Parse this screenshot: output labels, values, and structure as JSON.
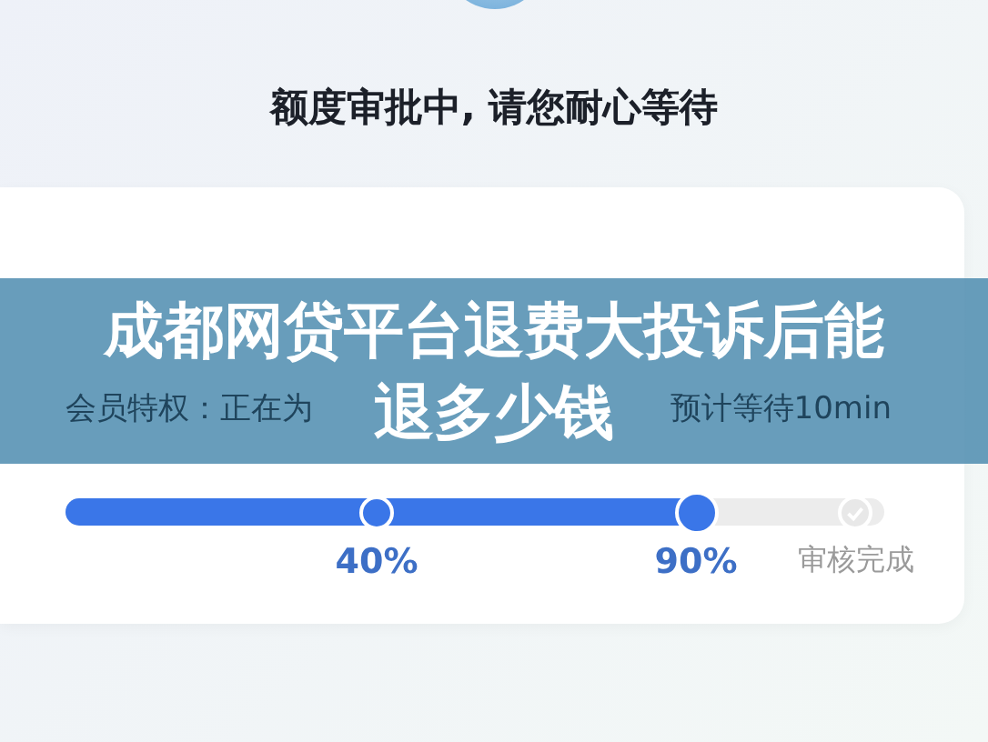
{
  "status_title": "额度审批中, 请您耐心等待",
  "card": {
    "subtitle_parts": [
      "会员特权：正在为",
      "预计等待10min"
    ]
  },
  "progress": {
    "level": 0.77,
    "steps": [
      {
        "label": "40%",
        "done": true
      },
      {
        "label": "90%",
        "done": true
      },
      {
        "label": "审核完成",
        "done": false
      }
    ]
  },
  "banner": {
    "title_lines": [
      "成都网贷平台退费大投诉后能",
      "退多少钱"
    ]
  }
}
